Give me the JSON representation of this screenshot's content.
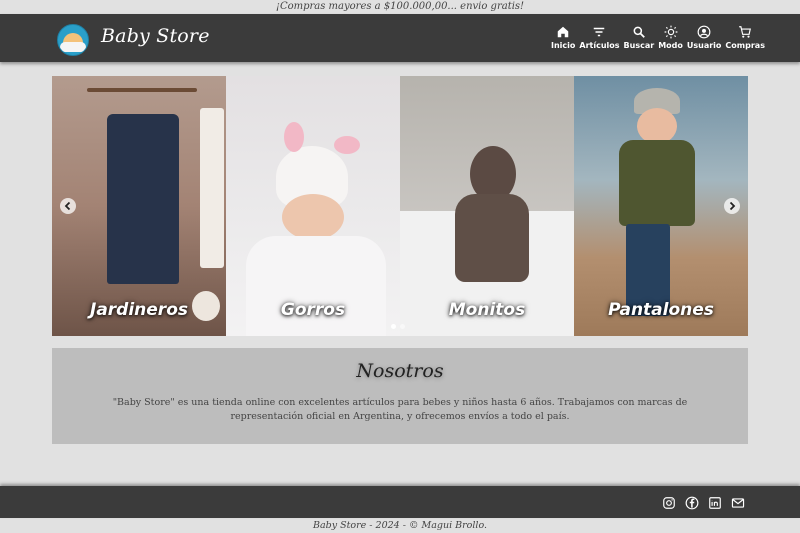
{
  "promo_banner": "¡Compras mayores a $100.000,00... envio gratis!",
  "header": {
    "brand": "Baby Store",
    "nav": [
      {
        "label": "Inicio",
        "icon": "home-icon"
      },
      {
        "label": "Artículos",
        "icon": "filter-icon"
      },
      {
        "label": "Buscar",
        "icon": "search-icon"
      },
      {
        "label": "Modo",
        "icon": "sun-icon"
      },
      {
        "label": "Usuario",
        "icon": "user-icon"
      },
      {
        "label": "Compras",
        "icon": "cart-icon"
      }
    ]
  },
  "carousel": {
    "slides": [
      {
        "caption": "Jardineros"
      },
      {
        "caption": "Gorros"
      },
      {
        "caption": "Monitos"
      },
      {
        "caption": "Pantalones"
      }
    ],
    "prev_icon": "chevron-left-icon",
    "next_icon": "chevron-right-icon"
  },
  "about": {
    "title": "Nosotros",
    "text": "\"Baby Store\" es una tienda online con excelentes artículos para bebes y niños hasta 6 años. Trabajamos con marcas de representación oficial en Argentina, y ofrecemos envíos a todo el país."
  },
  "footer": {
    "social": [
      "instagram-icon",
      "facebook-icon",
      "linkedin-icon",
      "mail-icon"
    ],
    "copyright": "Baby Store - 2024 - © Magui Brollo."
  },
  "colors": {
    "header_bg": "#3b3b3b",
    "page_bg": "#e1e1e1",
    "about_bg": "#bdbdbd"
  }
}
